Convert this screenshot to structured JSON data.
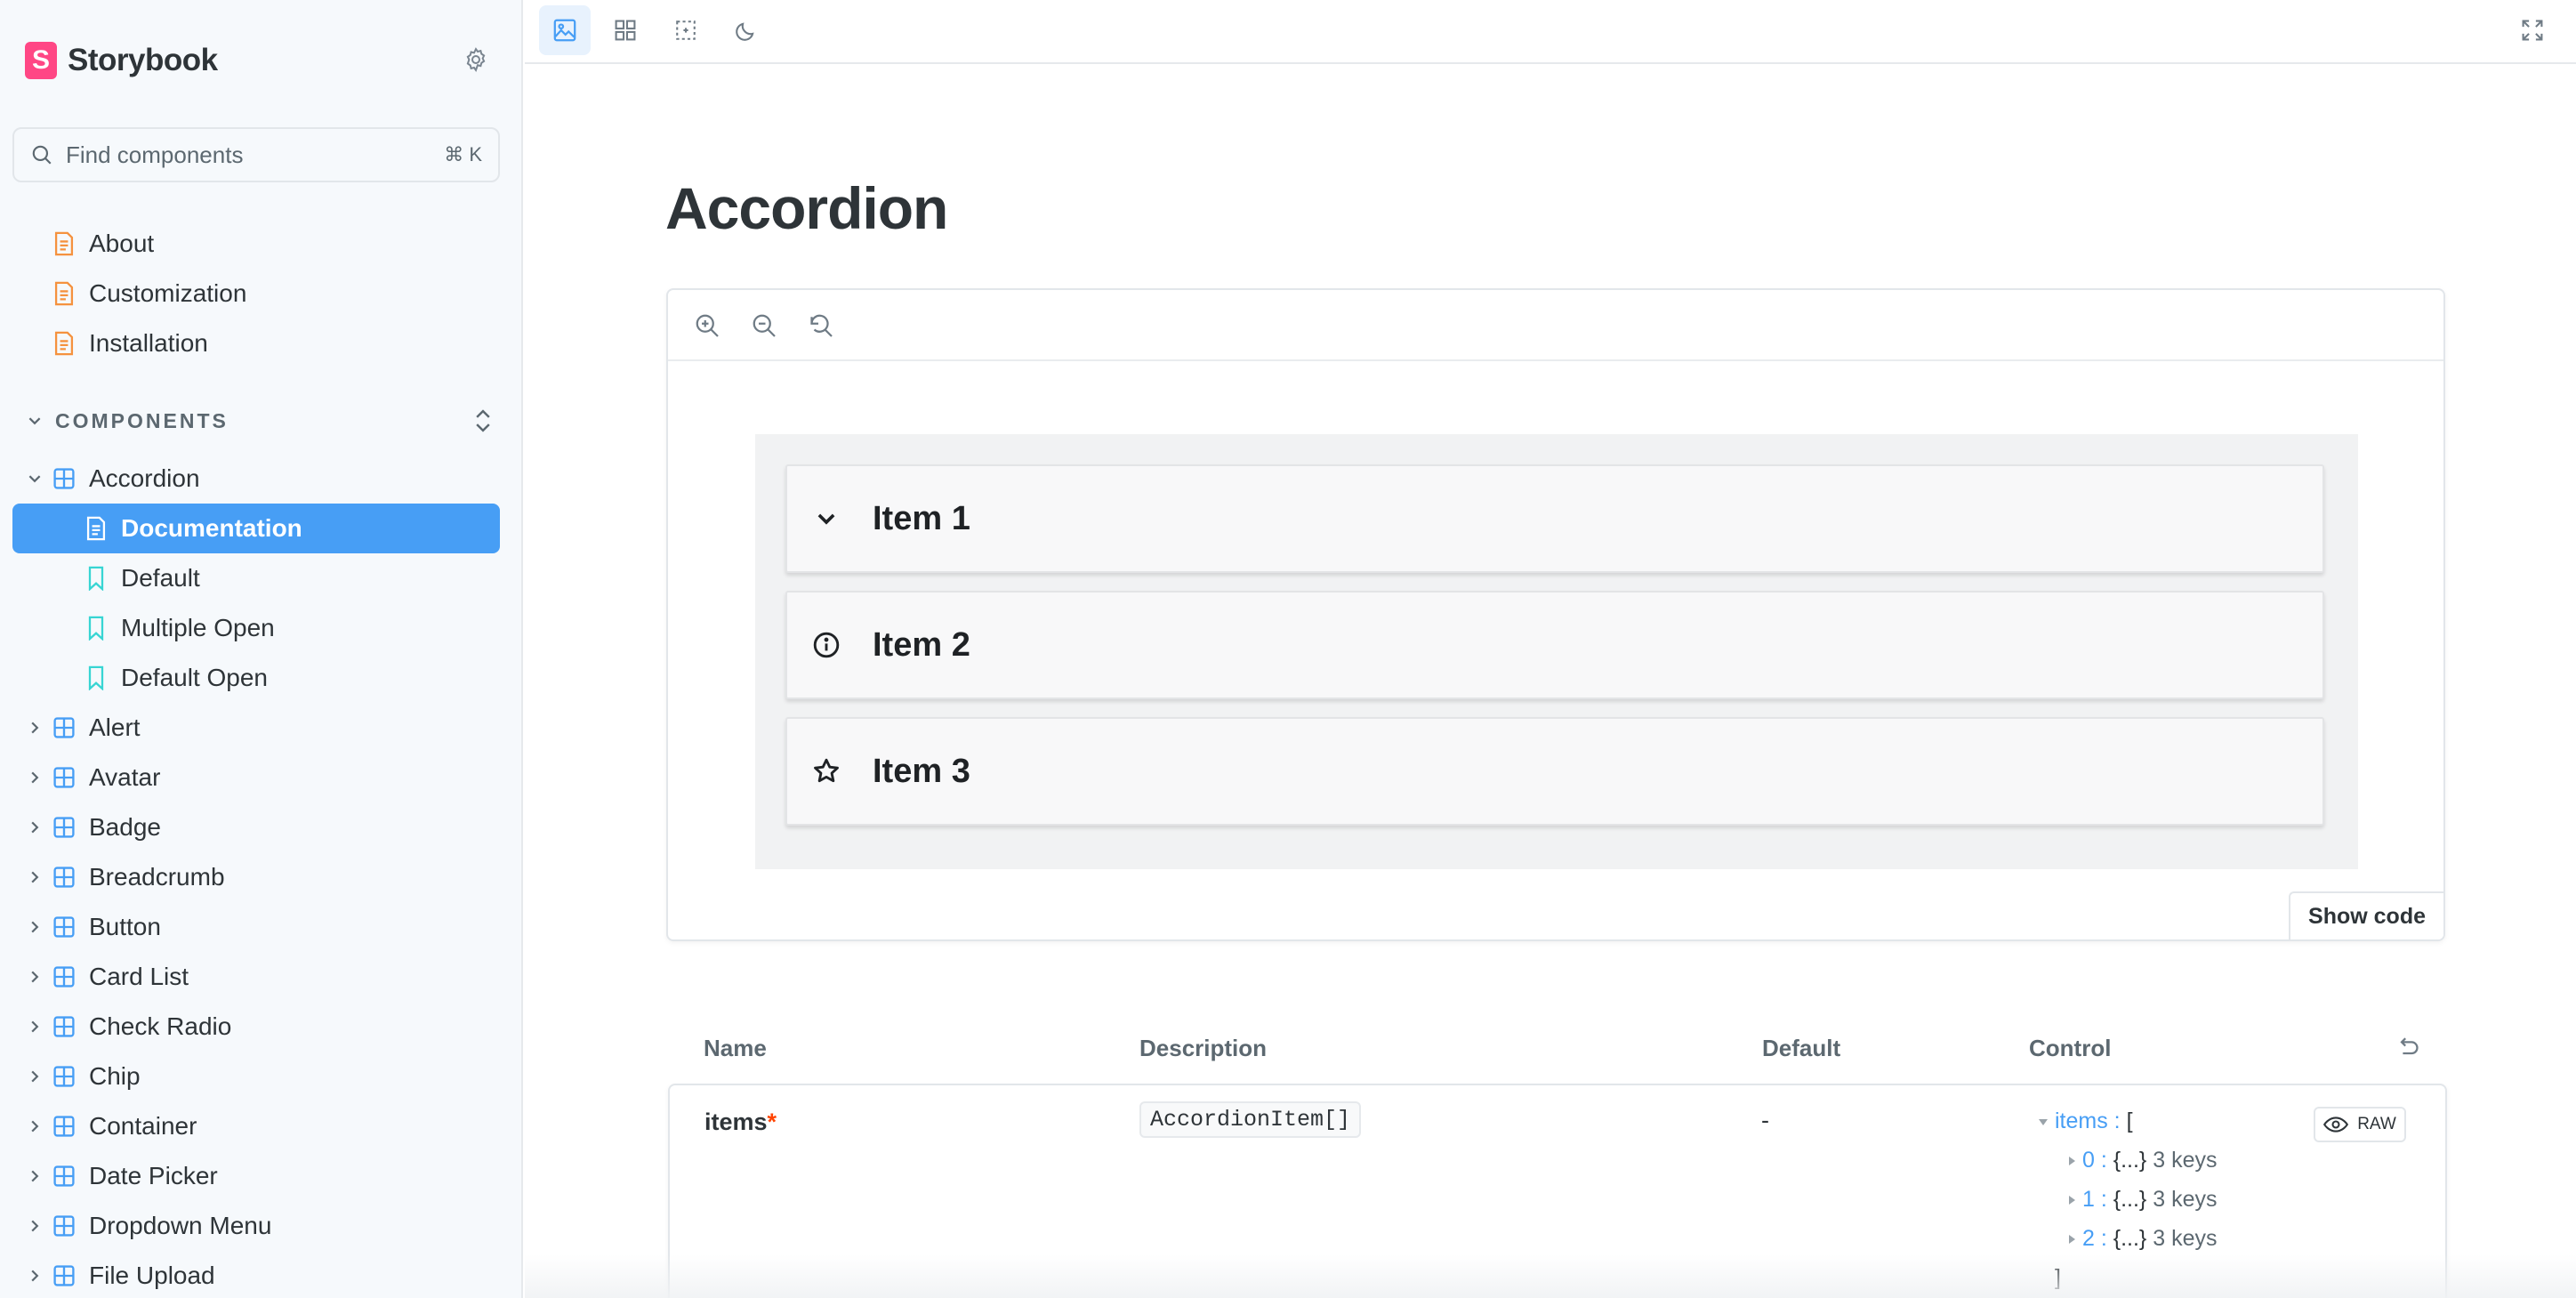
{
  "brand": {
    "name": "Storybook",
    "logo_letter": "S",
    "color": "#ff4785"
  },
  "search": {
    "placeholder": "Find components",
    "shortcut": "⌘ K"
  },
  "sidebar": {
    "docs": [
      {
        "label": "About"
      },
      {
        "label": "Customization"
      },
      {
        "label": "Installation"
      }
    ],
    "section_label": "COMPONENTS",
    "accordion": {
      "label": "Accordion",
      "children": [
        {
          "label": "Documentation",
          "active": true
        },
        {
          "label": "Default"
        },
        {
          "label": "Multiple Open"
        },
        {
          "label": "Default Open"
        }
      ]
    },
    "components": [
      {
        "label": "Alert"
      },
      {
        "label": "Avatar"
      },
      {
        "label": "Badge"
      },
      {
        "label": "Breadcrumb"
      },
      {
        "label": "Button"
      },
      {
        "label": "Card List"
      },
      {
        "label": "Check Radio"
      },
      {
        "label": "Chip"
      },
      {
        "label": "Container"
      },
      {
        "label": "Date Picker"
      },
      {
        "label": "Dropdown Menu"
      },
      {
        "label": "File Upload"
      }
    ]
  },
  "toolbar": {
    "buttons": [
      "image-icon",
      "grid-icon",
      "outline-icon",
      "moon-icon"
    ],
    "fullscreen": "fullscreen-icon"
  },
  "main": {
    "title": "Accordion",
    "preview": {
      "items": [
        {
          "label": "Item 1",
          "icon": "chevron-down-icon"
        },
        {
          "label": "Item 2",
          "icon": "info-icon"
        },
        {
          "label": "Item 3",
          "icon": "star-icon"
        }
      ],
      "show_code": "Show code"
    },
    "args_table": {
      "headers": {
        "name": "Name",
        "description": "Description",
        "default": "Default",
        "control": "Control"
      },
      "rows": [
        {
          "name": "items",
          "required_mark": "*",
          "type": "AccordionItem[]",
          "default": "-",
          "control": {
            "key": "items",
            "open": "[",
            "entries": [
              {
                "index": "0",
                "summary": "{...}",
                "count": "3 keys"
              },
              {
                "index": "1",
                "summary": "{...}",
                "count": "3 keys"
              },
              {
                "index": "2",
                "summary": "{...}",
                "count": "3 keys"
              }
            ],
            "close": "]",
            "raw_label": "RAW"
          }
        }
      ]
    }
  },
  "colors": {
    "accent": "#479ef5",
    "doc_icon": "#f5923e",
    "story_icon": "#37d5d3",
    "component_icon": "#479ef5"
  }
}
